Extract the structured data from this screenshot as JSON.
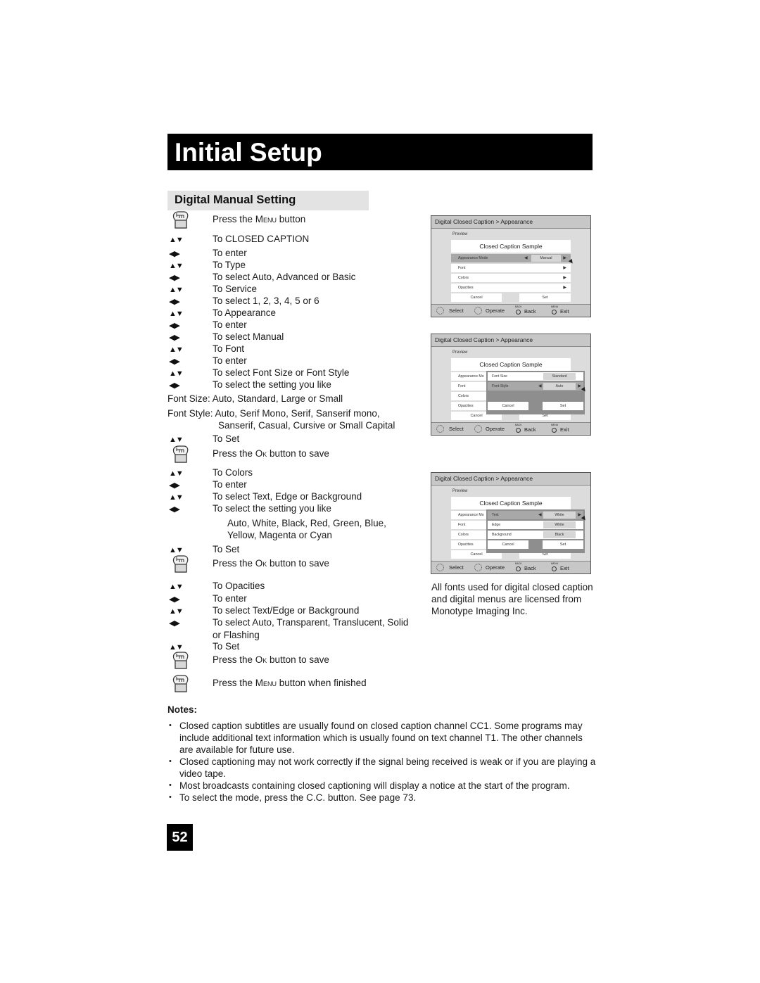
{
  "header": {
    "title": "Initial Setup"
  },
  "section": {
    "title": "Digital Manual Setting"
  },
  "steps": [
    {
      "icon": "hand",
      "pre": "Press the ",
      "key": "Menu",
      "post": " button"
    },
    {
      "icon": "updown",
      "text": "To CLOSED CAPTION"
    },
    {
      "icon": "leftright",
      "text": "To enter"
    },
    {
      "icon": "updown",
      "text": "To Type"
    },
    {
      "icon": "leftright",
      "text": "To select Auto, Advanced or Basic"
    },
    {
      "icon": "updown",
      "text": "To Service"
    },
    {
      "icon": "leftright",
      "text": "To select 1, 2, 3, 4, 5 or 6"
    },
    {
      "icon": "updown",
      "text": "To Appearance"
    },
    {
      "icon": "leftright",
      "text": "To enter"
    },
    {
      "icon": "leftright",
      "text": "To select Manual"
    },
    {
      "icon": "updown",
      "text": "To Font"
    },
    {
      "icon": "leftright",
      "text": "To enter"
    },
    {
      "icon": "updown",
      "text": "To select Font Size or Font Style"
    },
    {
      "icon": "leftright",
      "text": "To select the setting you like"
    }
  ],
  "font_size_line": "Font Size: Auto, Standard, Large or Small",
  "font_style_line1": "Font Style: Auto, Serif Mono, Serif, Sanserif mono,",
  "font_style_line2": "Sanserif, Casual, Cursive or Small Capital",
  "steps2": [
    {
      "icon": "updown",
      "text": "To Set"
    },
    {
      "icon": "hand",
      "pre": "Press the ",
      "key": "Ok",
      "post": " button to save"
    },
    {
      "icon": "updown",
      "text": "To Colors"
    },
    {
      "icon": "leftright",
      "text": "To enter"
    },
    {
      "icon": "updown",
      "text": "To select Text, Edge or Background"
    },
    {
      "icon": "leftright",
      "text": "To select the setting you like"
    }
  ],
  "colors_line1": "Auto, White, Black, Red, Green, Blue,",
  "colors_line2": "Yellow, Magenta or Cyan",
  "steps3": [
    {
      "icon": "updown",
      "text": "To Set"
    },
    {
      "icon": "hand",
      "pre": "Press the ",
      "key": "Ok",
      "post": " button to save"
    },
    {
      "icon": "updown",
      "text": "To Opacities"
    },
    {
      "icon": "leftright",
      "text": "To enter"
    },
    {
      "icon": "updown",
      "text": "To select Text/Edge or Background"
    },
    {
      "icon": "leftright",
      "text": "To select Auto, Transparent, Translucent, Solid"
    }
  ],
  "opacities_cont": "or Flashing",
  "steps4": [
    {
      "icon": "updown",
      "text": "To Set"
    },
    {
      "icon": "hand",
      "pre": "Press the ",
      "key": "Ok",
      "post": " button to save"
    },
    {
      "icon": "hand",
      "pre": "Press the ",
      "key": "Menu",
      "post": " button when finished"
    }
  ],
  "screens": [
    {
      "header": "Digital Closed Caption  >  Appearance",
      "preview_label": "Preview",
      "sample": "Closed Caption Sample",
      "rows": [
        {
          "label": "Appearance Mode",
          "value": "Manual",
          "selected": true
        },
        {
          "label": "Font"
        },
        {
          "label": "Colors"
        },
        {
          "label": "Opacities"
        }
      ],
      "cancel": "Cancel",
      "set": "Set",
      "footer": {
        "select": "Select",
        "operate": "Operate",
        "back_small": "BACK",
        "back": "Back",
        "menu_small": "MENU",
        "exit": "Exit"
      }
    },
    {
      "header": "Digital Closed Caption  >  Appearance",
      "preview_label": "Preview",
      "sample": "Closed Caption Sample",
      "rows": [
        {
          "label": "Appearance Mo"
        },
        {
          "label": "Font"
        },
        {
          "label": "Colors"
        },
        {
          "label": "Opacities"
        }
      ],
      "cancel": "Cancel",
      "set": "Set",
      "overlay": {
        "rows": [
          {
            "label": "Font Size",
            "value": "Standard"
          },
          {
            "label": "Font Style",
            "value": "Auto",
            "selected": true
          }
        ],
        "cancel": "Cancel",
        "set": "Set"
      },
      "footer": {
        "select": "Select",
        "operate": "Operate",
        "back_small": "BACK",
        "back": "Back",
        "menu_small": "MENU",
        "exit": "Exit"
      }
    },
    {
      "header": "Digital Closed Caption  >  Appearance",
      "preview_label": "Preview",
      "sample": "Closed Caption Sample",
      "rows": [
        {
          "label": "Appearance Mo"
        },
        {
          "label": "Font"
        },
        {
          "label": "Colors"
        },
        {
          "label": "Opacities"
        }
      ],
      "cancel": "Cancel",
      "set": "Set",
      "overlay": {
        "rows": [
          {
            "label": "Text",
            "value": "White",
            "selected": true
          },
          {
            "label": "Edge",
            "value": "White"
          },
          {
            "label": "Background",
            "value": "Black"
          }
        ],
        "cancel": "Cancel",
        "set": "Set"
      },
      "footer": {
        "select": "Select",
        "operate": "Operate",
        "back_small": "BACK",
        "back": "Back",
        "menu_small": "MENU",
        "exit": "Exit"
      }
    }
  ],
  "side_note": "All fonts used for digital closed caption and digital menus are licensed from Monotype Imaging Inc.",
  "notes": {
    "heading": "Notes:",
    "items": [
      "Closed caption subtitles are usually found on closed caption channel CC1. Some programs may include additional text information which is usually found on text channel T1. The other channels are available for future use.",
      "Closed captioning may not work correctly if the signal being received is weak or if you are playing a video tape.",
      "Most broadcasts containing closed captioning will display a notice at the start of the program.",
      "To select the mode, press the C.C. button. See page 73."
    ]
  },
  "page_number": "52"
}
